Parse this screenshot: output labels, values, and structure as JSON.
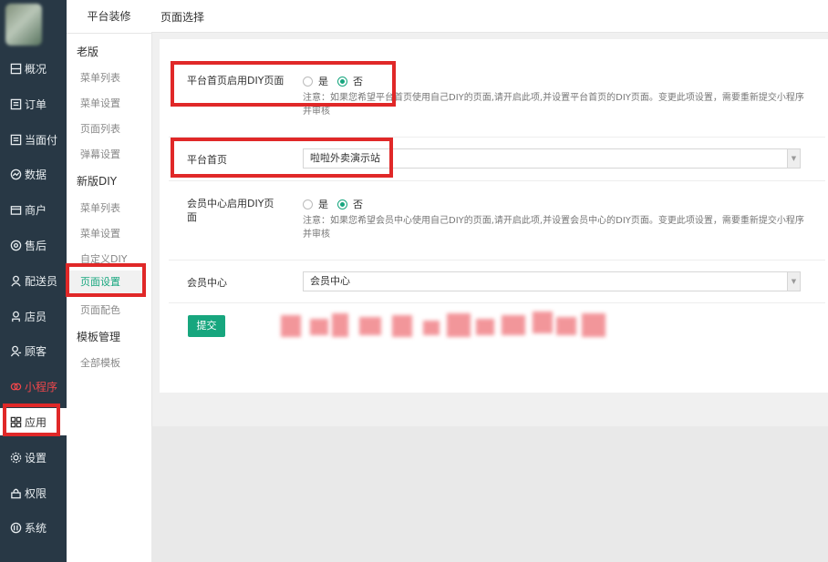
{
  "nav": {
    "items": [
      {
        "label": "概况",
        "icon": "dashboard-icon"
      },
      {
        "label": "订单",
        "icon": "order-icon"
      },
      {
        "label": "当面付",
        "icon": "payment-icon"
      },
      {
        "label": "数据",
        "icon": "chart-icon"
      },
      {
        "label": "商户",
        "icon": "store-icon"
      },
      {
        "label": "售后",
        "icon": "aftersale-icon"
      },
      {
        "label": "配送员",
        "icon": "courier-icon"
      },
      {
        "label": "店员",
        "icon": "clerk-icon"
      },
      {
        "label": "顾客",
        "icon": "customer-icon"
      },
      {
        "label": "小程序",
        "icon": "miniprogram-icon"
      },
      {
        "label": "应用",
        "icon": "apps-icon"
      },
      {
        "label": "设置",
        "icon": "gear-icon"
      },
      {
        "label": "权限",
        "icon": "lock-icon"
      },
      {
        "label": "系统",
        "icon": "system-icon"
      }
    ]
  },
  "sub": {
    "title": "平台装修",
    "groups": [
      {
        "label": "老版",
        "items": [
          "菜单列表",
          "菜单设置",
          "页面列表",
          "弹幕设置"
        ]
      },
      {
        "label": "新版DIY",
        "items": [
          "菜单列表",
          "菜单设置",
          "自定义DIY",
          "页面设置",
          "页面配色"
        ]
      },
      {
        "label": "模板管理",
        "items": [
          "全部模板"
        ]
      }
    ]
  },
  "topbar": {
    "title": "页面选择"
  },
  "form": {
    "platform_diy": {
      "label": "平台首页启用DIY页面",
      "yes": "是",
      "no": "否",
      "note": "注意：如果您希望平台首页使用自己DIY的页面,请开启此项,并设置平台首页的DIY页面。变更此项设置，需要重新提交小程序并审核"
    },
    "platform_home": {
      "label": "平台首页",
      "value": "啦啦外卖演示站"
    },
    "member_diy": {
      "label": "会员中心启用DIY页面",
      "yes": "是",
      "no": "否",
      "note": "注意：如果您希望会员中心使用自己DIY的页面,请开启此项,并设置会员中心的DIY页面。变更此项设置，需要重新提交小程序并审核"
    },
    "member_center": {
      "label": "会员中心",
      "value": "会员中心"
    },
    "submit": "提交"
  },
  "colors": {
    "accent": "#17a67e",
    "nav_bg": "#283845",
    "highlight": "#e02828",
    "active_nav": "#f0474b"
  }
}
